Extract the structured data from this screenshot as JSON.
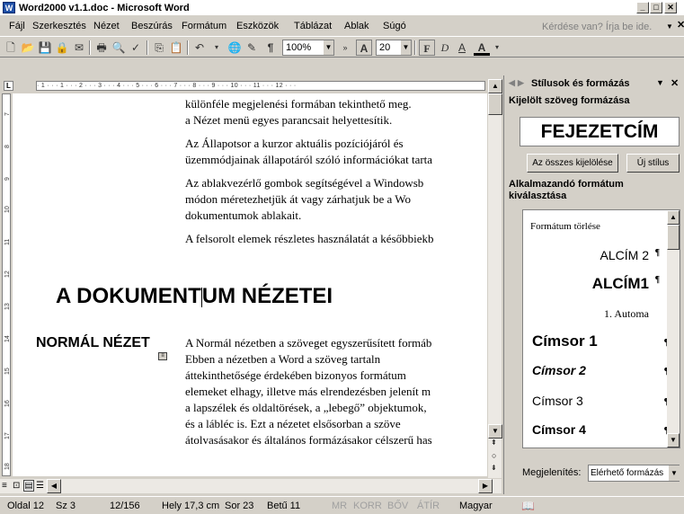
{
  "window": {
    "title": "Word2000 v1.1.doc - Microsoft Word",
    "app_icon": "W"
  },
  "menu": [
    "Fájl",
    "Szerkesztés",
    "Nézet",
    "Beszúrás",
    "Formátum",
    "Eszközök",
    "Táblázat",
    "Ablak",
    "Súgó"
  ],
  "help_box": {
    "placeholder": "Kérdése van? Írja be ide."
  },
  "toolbar": {
    "zoom": "100%",
    "font_size": "20"
  },
  "ruler": {
    "h_text": "· 1 · · · 1 · · · 2 · · · 3 · · · 4 · · · 5 · · · 6 · · · 7 · · · 8 · · · 9 · · · 10 · · · 11 · · · 12 · · ·",
    "v_labels": [
      "7",
      "8",
      "9",
      "10",
      "11",
      "12",
      "13",
      "14",
      "15",
      "16",
      "17",
      "18"
    ]
  },
  "document": {
    "paragraphs": [
      "különféle megjelenési formában tekinthető meg.",
      "a Nézet menü egyes parancsait helyettesítik.",
      "Az Állapotsor a kurzor aktuális pozíciójáról és",
      "üzemmódjainak állapotáról szóló információkat tarta",
      "Az ablakvezérlő gombok segítségével a Windowsb",
      "módon méretezhetjük át vagy zárhatjuk be a Wo",
      "dokumentumok ablakait.",
      "A felsorolt elemek részletes használatát a későbbiekb"
    ],
    "heading1_part1": "A DOKUMENT",
    "heading1_part2": "UM NÉZETEI",
    "heading2": "NORMÁL NÉZET",
    "body_lines": [
      "A Normál nézetben a szöveget egyszerűsített formáb",
      "Ebben a nézetben a Word a szöveg tartaln",
      "áttekinthetősége érdekében bizonyos formátum",
      "elemeket elhagy, illetve más elrendezésben jelenít m",
      "a lapszélek és oldaltörések, a „lebegő” objektumok,",
      "és a lábléc is. Ezt a nézetet elsősorban a szöve",
      "átolvasásakor és általános formázásakor célszerű has"
    ]
  },
  "status": {
    "page": "Oldal 12",
    "section": "Sz 3",
    "pages": "12/156",
    "position": "Hely 17,3 cm",
    "line": "Sor 23",
    "column": "Betű 11",
    "rec": "MR",
    "trk": "KORR",
    "ext": "BŐV",
    "ovr": "ÁTÍR",
    "language": "Magyar"
  },
  "task_pane": {
    "title": "Stílusok és formázás",
    "selected_label": "Kijelölt szöveg formázása",
    "selected_style": "FEJEZETCÍM",
    "select_all_button": "Az összes kijelölése",
    "new_style_button": "Új stílus",
    "apply_label_1": "Alkalmazandó formátum",
    "apply_label_2": "kiválasztása",
    "format_items": [
      "Formátum törlése",
      "ALCÍM 2",
      "ALCÍM1",
      "1. Automa",
      "Címsor 1",
      "Címsor 2",
      "Címsor 3",
      "Címsor 4"
    ],
    "show_label": "Megjelenítés:",
    "show_value": "Elérhető formázás"
  }
}
